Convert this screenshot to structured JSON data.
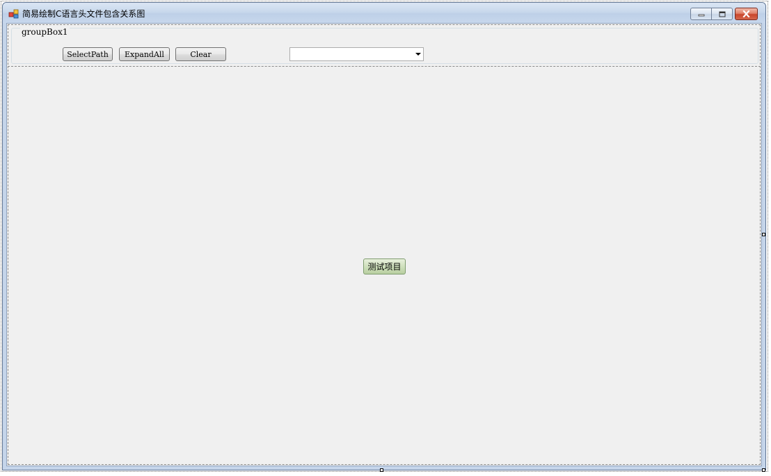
{
  "window": {
    "title": "简易绘制C语言头文件包含关系图",
    "icon": "app-icon",
    "controls": {
      "minimize": "minimize-icon",
      "maximize": "maximize-icon",
      "close": "close-icon"
    }
  },
  "groupbox": {
    "label": "groupBox1",
    "buttons": {
      "select_path": "SelectPath",
      "expand_all": "ExpandAll",
      "clear": "Clear"
    },
    "combo": {
      "value": ""
    }
  },
  "main": {
    "test_button": "测试项目"
  },
  "colors": {
    "client_bg": "#f0f0f0",
    "titlebar": "#c8d8ec",
    "close_button": "#c9462c",
    "test_button": "#cfe0bd"
  }
}
